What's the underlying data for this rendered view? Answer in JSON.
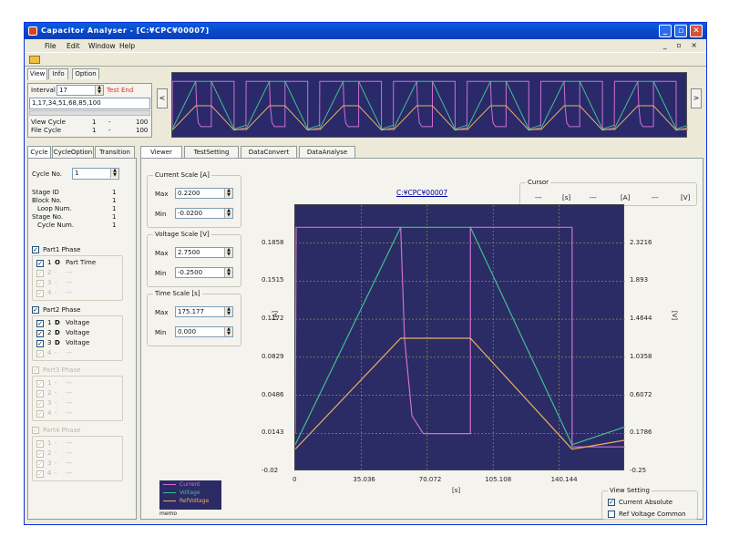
{
  "window": {
    "title": "Capacitor Analyser - [C:¥CPC¥00007]",
    "menu": [
      "File",
      "Edit",
      "Window",
      "Help"
    ],
    "mdi_buttons": "_ ▫ ×"
  },
  "view_panel": {
    "tabs": [
      "View",
      "Info",
      "Option"
    ],
    "interval_label": "Interval",
    "interval_value": "17",
    "test_end": "Test End",
    "cycles_list": "1,17,34,51,68,85,100",
    "view_cycle_label": "View Cycle",
    "view_cycle_from": "1",
    "view_cycle_sep": "-",
    "view_cycle_to": "100",
    "file_cycle_label": "File Cycle",
    "file_cycle_from": "1",
    "file_cycle_sep": "-",
    "file_cycle_to": "100",
    "prev": "<",
    "next": ">"
  },
  "left_panel": {
    "tabs": [
      "Cycle",
      "CycleOption",
      "Transition"
    ],
    "cycle_no_label": "Cycle No.",
    "cycle_no_value": "1",
    "info": [
      {
        "label": "Stage ID",
        "value": "1"
      },
      {
        "label": "Block No.",
        "value": "1"
      },
      {
        "label": "Loop Num.",
        "value": "1"
      },
      {
        "label": "Stage No.",
        "value": "1"
      },
      {
        "label": "Cycle Num.",
        "value": "1"
      }
    ],
    "phases": [
      {
        "title": "Part1 Phase",
        "enabled": true,
        "rows": [
          {
            "num": "1",
            "code": "O",
            "name": "Part Time",
            "on": true
          },
          {
            "num": "2",
            "code": "-",
            "name": "---",
            "on": false
          },
          {
            "num": "3",
            "code": "-",
            "name": "---",
            "on": false
          },
          {
            "num": "4",
            "code": "-",
            "name": "---",
            "on": false
          }
        ]
      },
      {
        "title": "Part2 Phase",
        "enabled": true,
        "rows": [
          {
            "num": "1",
            "code": "D",
            "name": "Voltage",
            "on": true
          },
          {
            "num": "2",
            "code": "D",
            "name": "Voltage",
            "on": true
          },
          {
            "num": "3",
            "code": "D",
            "name": "Voltage",
            "on": true
          },
          {
            "num": "4",
            "code": "-",
            "name": "---",
            "on": false
          }
        ]
      },
      {
        "title": "Part3 Phase",
        "enabled": false,
        "rows": [
          {
            "num": "1",
            "code": "-",
            "name": "---",
            "on": false
          },
          {
            "num": "2",
            "code": "-",
            "name": "---",
            "on": false
          },
          {
            "num": "3",
            "code": "-",
            "name": "---",
            "on": false
          },
          {
            "num": "4",
            "code": "-",
            "name": "---",
            "on": false
          }
        ]
      },
      {
        "title": "Part4 Phase",
        "enabled": false,
        "rows": [
          {
            "num": "1",
            "code": "-",
            "name": "---",
            "on": false
          },
          {
            "num": "2",
            "code": "-",
            "name": "---",
            "on": false
          },
          {
            "num": "3",
            "code": "-",
            "name": "---",
            "on": false
          },
          {
            "num": "4",
            "code": "-",
            "name": "---",
            "on": false
          }
        ]
      }
    ]
  },
  "main": {
    "tabs": [
      "Viewer",
      "TestSetting",
      "DataConvert",
      "DataAnalyse"
    ],
    "current_scale": {
      "title": "Current Scale [A]",
      "max_label": "Max",
      "max": "0.2200",
      "min_label": "Min",
      "min": "-0.0200"
    },
    "voltage_scale": {
      "title": "Voltage Scale [V]",
      "max_label": "Max",
      "max": "2.7500",
      "min_label": "Min",
      "min": "-0.2500"
    },
    "time_scale": {
      "title": "Time Scale [s]",
      "max_label": "Max",
      "max": "175.177",
      "min_label": "Min",
      "min": "0.000"
    },
    "file_link": "C:¥CPC¥00007",
    "cursor": {
      "title": "Cursor",
      "cells": [
        "---",
        "[s]",
        "---",
        "[A]",
        "---",
        "[V]"
      ]
    },
    "legend": [
      "Current",
      "Voltage",
      "RefVoltage"
    ],
    "memo": "memo",
    "view_setting": {
      "title": "View Setting",
      "current_absolute": "Current Absolute",
      "current_absolute_checked": true,
      "ref_voltage_common": "Ref Voltage Common",
      "ref_voltage_common_checked": false
    }
  },
  "colors": {
    "plot_bg": "#2b2b66",
    "current": "#d070d0",
    "voltage": "#40c090",
    "ref_voltage": "#e8b060",
    "grid": "#a0a040",
    "title_blue": "#0a4fd0"
  },
  "chart_data": {
    "type": "line",
    "x_ticks": [
      "0",
      "35.036",
      "70.072",
      "105.108",
      "140.144"
    ],
    "y_left_ticks": [
      "0.1858",
      "0.1515",
      "0.1172",
      "0.0829",
      "0.0486",
      "0.0143",
      "-0.02"
    ],
    "y_right_ticks": [
      "2.3216",
      "1.893",
      "1.4644",
      "1.0358",
      "0.6072",
      "0.1786",
      "-0.25"
    ],
    "xlabel": "[s]",
    "ylabel_left": "[A]",
    "ylabel_right": "[V]",
    "xlim": [
      0,
      175.177
    ],
    "ylim_left": [
      -0.02,
      0.22
    ],
    "ylim_right": [
      -0.25,
      2.75
    ],
    "series": [
      {
        "name": "Current",
        "axis": "left",
        "points": [
          [
            0,
            0.0143
          ],
          [
            0.5,
            0.2
          ],
          [
            56,
            0.2
          ],
          [
            58,
            0.1
          ],
          [
            62,
            0.03
          ],
          [
            68,
            0.014
          ],
          [
            93,
            0.014
          ],
          [
            93,
            0.2
          ],
          [
            147,
            0.2
          ],
          [
            147,
            0.002
          ],
          [
            175,
            0.002
          ]
        ]
      },
      {
        "name": "Voltage",
        "axis": "right",
        "points": [
          [
            0,
            0.05
          ],
          [
            56,
            2.5
          ],
          [
            93,
            2.5
          ],
          [
            147,
            0.05
          ],
          [
            175,
            0.25
          ]
        ]
      },
      {
        "name": "RefVoltage",
        "axis": "right",
        "points": [
          [
            0,
            0.0
          ],
          [
            56,
            1.25
          ],
          [
            93,
            1.25
          ],
          [
            147,
            0.0
          ],
          [
            175,
            0.1
          ]
        ]
      }
    ]
  }
}
